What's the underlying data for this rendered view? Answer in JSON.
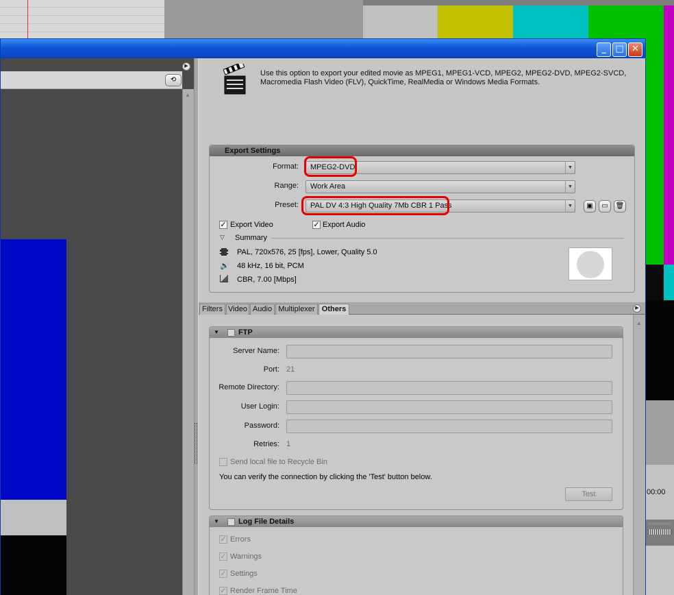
{
  "background": {
    "color_bars": [
      "#c0c0c0",
      "#c0c000",
      "#00c0c0",
      "#00c000",
      "#c000c0"
    ]
  },
  "window": {
    "buttons": {
      "minimize": "_",
      "maximize": "□",
      "close": "✕"
    }
  },
  "description": "Use this option to export your edited movie as MPEG1, MPEG1-VCD, MPEG2, MPEG2-DVD, MPEG2-SVCD, Macromedia Flash Video (FLV), QuickTime, RealMedia or Windows Media Formats.",
  "export_settings": {
    "title": "Export Settings",
    "format_label": "Format:",
    "format_value": "MPEG2-DVD",
    "range_label": "Range:",
    "range_value": "Work Area",
    "preset_label": "Preset:",
    "preset_value": "PAL DV 4:3 High Quality 7Mb CBR 1 Pass",
    "export_video_label": "Export Video",
    "export_video_checked": true,
    "export_audio_label": "Export Audio",
    "export_audio_checked": true,
    "summary_label": "Summary",
    "summary_video": "PAL, 720x576, 25 [fps], Lower, Quality 5.0",
    "summary_audio": "48 kHz, 16 bit, PCM",
    "summary_bitrate": "CBR, 7.00 [Mbps]",
    "highlight_color": "#e60000"
  },
  "tabs": [
    "Filters",
    "Video",
    "Audio",
    "Multiplexer",
    "Others"
  ],
  "active_tab": "Others",
  "ftp": {
    "title": "FTP",
    "server_name_label": "Server Name:",
    "server_name_value": "",
    "port_label": "Port:",
    "port_value": "21",
    "remote_directory_label": "Remote Directory:",
    "remote_directory_value": "",
    "user_login_label": "User Login:",
    "user_login_value": "",
    "password_label": "Password:",
    "password_value": "",
    "retries_label": "Retries:",
    "retries_value": "1",
    "recycle_label": "Send local file to Recycle Bin",
    "verify_text": "You can verify the connection by clicking the 'Test' button below.",
    "test_button": "Test"
  },
  "log_file": {
    "title": "Log File Details",
    "items": [
      "Errors",
      "Warnings",
      "Settings",
      "Render Frame Time"
    ]
  },
  "right_edge": {
    "timecode": "00:00"
  }
}
